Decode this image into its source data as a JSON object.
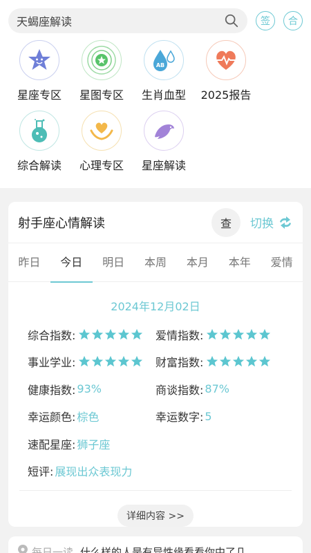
{
  "search": {
    "text": "天蝎座解读"
  },
  "header_buttons": {
    "sign": "签",
    "match": "合"
  },
  "categories": [
    {
      "label": "星座专区",
      "icon": "star-face-icon",
      "color": "#6f7fd8"
    },
    {
      "label": "星图专区",
      "icon": "astro-chart-icon",
      "color": "#58c36a"
    },
    {
      "label": "生肖血型",
      "icon": "blood-type-icon",
      "color": "#4aa7d8"
    },
    {
      "label": "2025报告",
      "icon": "heart-pulse-icon",
      "color": "#ef7a5a"
    },
    {
      "label": "综合解读",
      "icon": "flask-icon",
      "color": "#4dbdb6"
    },
    {
      "label": "心理专区",
      "icon": "heart-hands-icon",
      "color": "#f3b84a"
    },
    {
      "label": "星座解读",
      "icon": "dolphin-icon",
      "color": "#a283d8"
    }
  ],
  "card": {
    "title": "射手座心情解读",
    "check_label": "查",
    "switch_label": "切换",
    "tabs": [
      "昨日",
      "今日",
      "明日",
      "本周",
      "本月",
      "本年",
      "爱情"
    ],
    "active_tab": "今日",
    "date": "2024年12月02日",
    "indices": {
      "overall": {
        "label": "综合指数:",
        "stars": 5
      },
      "love": {
        "label": "爱情指数:",
        "stars": 5
      },
      "career": {
        "label": "事业学业:",
        "stars": 5
      },
      "wealth": {
        "label": "财富指数:",
        "stars": 5
      },
      "health": {
        "label": "健康指数:",
        "value": "93%"
      },
      "negotiation": {
        "label": "商谈指数:",
        "value": "87%"
      },
      "lucky_color": {
        "label": "幸运颜色:",
        "value": "棕色"
      },
      "lucky_number": {
        "label": "幸运数字:",
        "value": "5"
      },
      "match": {
        "label": "速配星座:",
        "value": "狮子座"
      },
      "comment": {
        "label": "短评:",
        "value": "展现出众表现力"
      }
    },
    "detail_label": "详细内容 >>"
  },
  "bottom": {
    "tag": "每日一读",
    "text": "什么样的人是有异性缘看看你中了几"
  },
  "colors": {
    "accent": "#6cc8d3",
    "star": "#5cc6d0"
  }
}
